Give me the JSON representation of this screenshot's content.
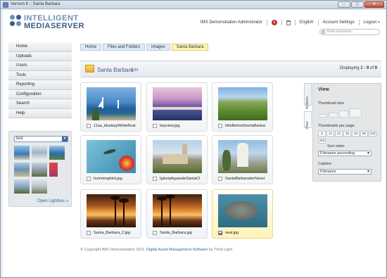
{
  "window": {
    "title": "Version 6 :: Santa Barbara",
    "controls": [
      "minimize",
      "maximize",
      "close"
    ]
  },
  "logo": {
    "line1": "INTELLIGENT",
    "line2": "MEDIASERVER"
  },
  "topnav": {
    "user": "IMS Demonstration Administrator",
    "notification_count": "1",
    "language": "English",
    "account": "Account Settings",
    "logout": "Logout »"
  },
  "search": {
    "placeholder": "Enter keywords..."
  },
  "sidebar": {
    "items": [
      "Home",
      "Uploads",
      "Users",
      "Tools",
      "Reporting",
      "Configuration",
      "Search",
      "Help"
    ]
  },
  "lightbox": {
    "selected": "test",
    "open_label": "Open Lightbox »"
  },
  "breadcrumb": [
    "Home",
    "Files and Folders",
    "Images",
    "Santa Barbara"
  ],
  "folder": {
    "name": "Santa Barbara",
    "edit": "Edit",
    "display_prefix": "Displaying ",
    "display_range": "1 - 9",
    "display_of": " of ",
    "display_total": "9"
  },
  "files": [
    {
      "name": "11aa_bluebayWhiteBoat",
      "checked": false
    },
    {
      "name": "bayview.jpg",
      "checked": false
    },
    {
      "name": "hillsBehindSantaBarbar",
      "checked": false
    },
    {
      "name": "hummingbird.jpg",
      "checked": false
    },
    {
      "name": "IglesiaAguasdeSantaCl",
      "checked": false
    },
    {
      "name": "SantaBarbaraderNesel",
      "checked": false
    },
    {
      "name": "Santa_Barbara_2.jpg",
      "checked": false
    },
    {
      "name": "Santa_Barbara.jpg",
      "checked": false
    },
    {
      "name": "seal.jpg",
      "checked": true
    }
  ],
  "footer": {
    "copyright": "© Copyright IMS Demonstration 2011.",
    "link": "Digital Asset Management Software",
    "by": " by Third Light"
  },
  "side_tabs": {
    "actions": "Actions",
    "view": "View"
  },
  "view_panel": {
    "title": "View",
    "thumb_size_label": "Thumbnail size",
    "per_page_label": "Thumbnails per page",
    "per_page_options": [
      "8",
      "12",
      "24",
      "35",
      "48",
      "96",
      "100",
      "150"
    ],
    "sort_label": "Sort order",
    "sort_value": "Filename ascending",
    "caption_label": "Caption",
    "caption_value": "Filename"
  },
  "colors": {
    "accent": "#3a5d85",
    "selected_tile": "#fff3b8",
    "badge": "#c0302a",
    "link": "#2a66b0"
  }
}
